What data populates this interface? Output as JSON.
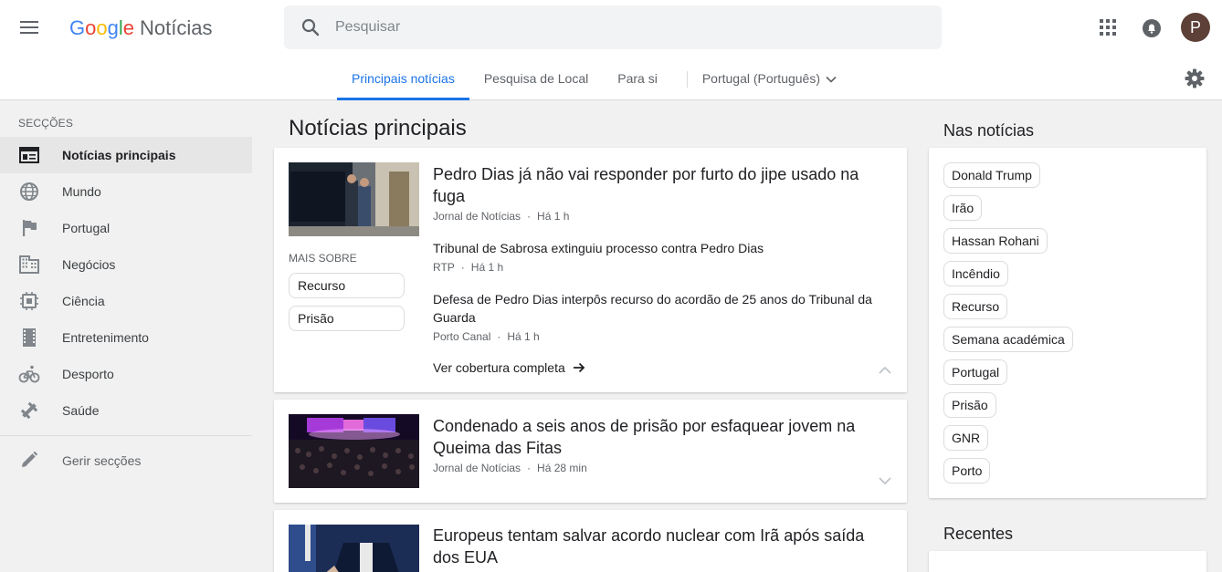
{
  "header": {
    "logo_letters": [
      "G",
      "o",
      "o",
      "g",
      "l",
      "e"
    ],
    "logo_product": "Notícias",
    "search_placeholder": "Pesquisar",
    "avatar_letter": "P"
  },
  "tabs": [
    {
      "label": "Principais notícias",
      "active": true
    },
    {
      "label": "Pesquisa de Local",
      "active": false
    },
    {
      "label": "Para si",
      "active": false
    }
  ],
  "region": {
    "label": "Portugal (Português)"
  },
  "sidebar": {
    "title": "SECÇÕES",
    "items": [
      {
        "label": "Notícias principais",
        "icon": "newspaper-icon",
        "active": true
      },
      {
        "label": "Mundo",
        "icon": "globe-icon"
      },
      {
        "label": "Portugal",
        "icon": "flag-icon"
      },
      {
        "label": "Negócios",
        "icon": "building-icon"
      },
      {
        "label": "Ciência",
        "icon": "chip-icon"
      },
      {
        "label": "Entretenimento",
        "icon": "film-icon"
      },
      {
        "label": "Desporto",
        "icon": "bike-icon"
      },
      {
        "label": "Saúde",
        "icon": "dumbbell-icon"
      }
    ],
    "manage_label": "Gerir secções"
  },
  "main": {
    "title": "Notícias principais",
    "stories": [
      {
        "headline": "Pedro Dias já não vai responder por furto do jipe usado na fuga",
        "source": "Jornal de Notícias",
        "time": "Há 1 h",
        "more_label": "MAIS SOBRE",
        "chips": [
          "Recurso",
          "Prisão"
        ],
        "related": [
          {
            "headline": "Tribunal de Sabrosa extinguiu processo contra Pedro Dias",
            "source": "RTP",
            "time": "Há 1 h"
          },
          {
            "headline": "Defesa de Pedro Dias interpôs recurso do acordão de 25 anos do Tribunal da Guarda",
            "source": "Porto Canal",
            "time": "Há 1 h"
          }
        ],
        "full_coverage": "Ver cobertura completa"
      },
      {
        "headline": "Condenado a seis anos de prisão por esfaquear jovem na Queima das Fitas",
        "source": "Jornal de Notícias",
        "time": "Há 28 min"
      },
      {
        "headline": "Europeus tentam salvar acordo nuclear com Irã após saída dos EUA"
      }
    ]
  },
  "right": {
    "in_news_title": "Nas notícias",
    "topics": [
      "Donald Trump",
      "Irão",
      "Hassan Rohani",
      "Incêndio",
      "Recurso",
      "Semana académica",
      "Portugal",
      "Prisão",
      "GNR",
      "Porto"
    ],
    "recent_title": "Recentes"
  },
  "colors": {
    "accent": "#1a73e8",
    "avatar": "#5d4037"
  }
}
